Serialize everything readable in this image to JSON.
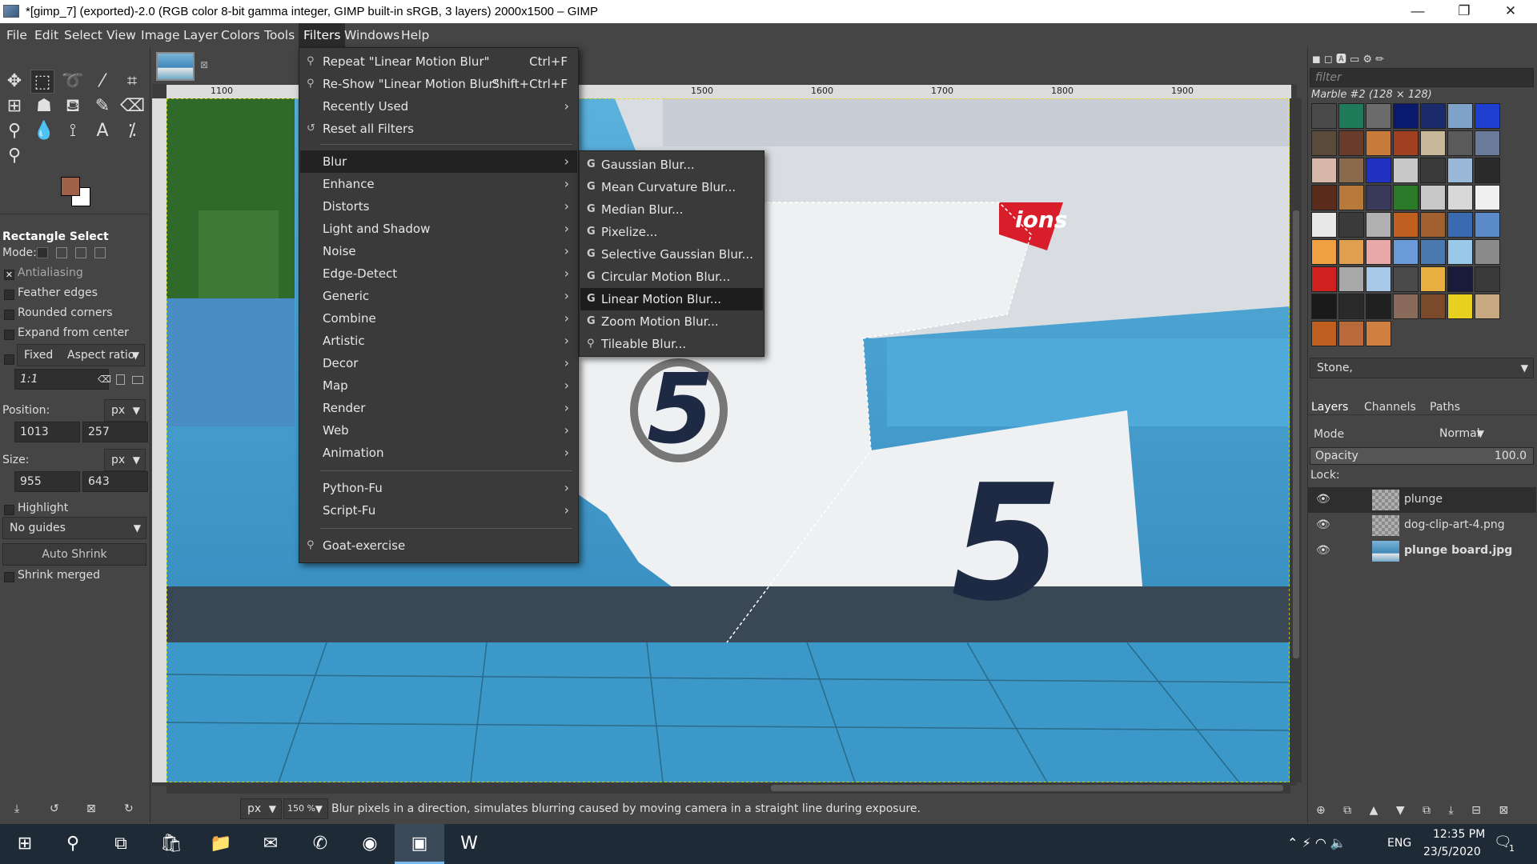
{
  "window": {
    "title": "*[gimp_7] (exported)-2.0 (RGB color 8-bit gamma integer, GIMP built-in sRGB, 3 layers) 2000x1500 – GIMP",
    "minimize": "—",
    "restore": "❐",
    "close": "✕"
  },
  "menubar": [
    "File",
    "Edit",
    "Select",
    "View",
    "Image",
    "Layer",
    "Colors",
    "Tools",
    "Filters",
    "Windows",
    "Help"
  ],
  "filters_menu": {
    "repeat": {
      "label": "Repeat \"Linear Motion Blur\"",
      "accel": "Ctrl+F"
    },
    "reshow": {
      "label": "Re-Show \"Linear Motion Blur\"",
      "accel": "Shift+Ctrl+F"
    },
    "recent": "Recently Used",
    "reset": "Reset all Filters",
    "groups": [
      "Blur",
      "Enhance",
      "Distorts",
      "Light and Shadow",
      "Noise",
      "Edge-Detect",
      "Generic",
      "Combine",
      "Artistic",
      "Decor",
      "Map",
      "Render",
      "Web",
      "Animation"
    ],
    "scripts": [
      "Python-Fu",
      "Script-Fu"
    ],
    "goat": "Goat-exercise"
  },
  "blur_menu": [
    "Gaussian Blur...",
    "Mean Curvature Blur...",
    "Median Blur...",
    "Pixelize...",
    "Selective Gaussian Blur...",
    "Circular Motion Blur...",
    "Linear Motion Blur...",
    "Zoom Motion Blur...",
    "Tileable Blur..."
  ],
  "tool_options": {
    "title": "Rectangle Select",
    "mode_label": "Mode:",
    "antialiasing": "Antialiasing",
    "feather": "Feather edges",
    "rounded": "Rounded corners",
    "expand": "Expand from center",
    "fixed": "Fixed",
    "fixed_value": "Aspect ratio",
    "ratio": "1:1",
    "position_label": "Position:",
    "unit": "px",
    "pos_x": "1013",
    "pos_y": "257",
    "size_label": "Size:",
    "size_w": "955",
    "size_h": "643",
    "highlight": "Highlight",
    "guides": "No guides",
    "auto_shrink": "Auto Shrink",
    "shrink_merged": "Shrink merged"
  },
  "ruler_ticks": [
    "1100",
    "1500",
    "1600",
    "1700",
    "1800",
    "1900"
  ],
  "canvas_text": {
    "number": "5",
    "sign": "ions"
  },
  "status": {
    "unit": "px",
    "zoom": "150 %",
    "message": "Blur pixels in a direction, simulates blurring caused by moving camera in a straight line during exposure."
  },
  "patterns": {
    "filter_placeholder": "filter",
    "name": "Marble #2 (128 × 128)",
    "selected": "Stone,",
    "swatches": [
      "#4a4a4a",
      "#1f7a5a",
      "#6b6b6b",
      "#0a1a6e",
      "#1a2a6a",
      "#7ea2c8",
      "#1e3fcf",
      "#5a4a3a",
      "#6a3a2a",
      "#c87a3a",
      "#a04020",
      "#c8b89a",
      "#5a5a5a",
      "#6a7a9a",
      "#d8b8a8",
      "#8a6a4a",
      "#2030c0",
      "#c8c8c8",
      "#3a3a3a",
      "#9ab8d8",
      "#2a2a2a",
      "#5a2a1a",
      "#b87a3a",
      "#3a3a5a",
      "#2a7a2a",
      "#c8c8c8",
      "#d8d8d8",
      "#f0f0f0",
      "#e8e8e8",
      "#3a3a3a",
      "#b0b0b0",
      "#c06020",
      "#a06030",
      "#3a6ab0",
      "#5a8ac8",
      "#f0a040",
      "#e0a050",
      "#e8a8a8",
      "#6a9ad8",
      "#4a7ab0",
      "#9ac8e8",
      "#8a8a8a",
      "#d02020",
      "#a8a8a8",
      "#a8c8e8",
      "#4a4a4a",
      "#e8b040",
      "#1a1a3a",
      "#3a3a3a",
      "#1a1a1a",
      "#2a2a2a",
      "#202020",
      "#8a6a5a",
      "#7a4a2a",
      "#e8d020",
      "#c8a880",
      "#c06020",
      "#b86a3a",
      "#d08040"
    ]
  },
  "layers": {
    "tabs": [
      "Layers",
      "Channels",
      "Paths"
    ],
    "mode_label": "Mode",
    "mode_value": "Normal",
    "opacity_label": "Opacity",
    "opacity_value": "100.0",
    "lock_label": "Lock:",
    "items": [
      {
        "name": "plunge"
      },
      {
        "name": "dog-clip-art-4.png"
      },
      {
        "name": "plunge board.jpg"
      }
    ]
  },
  "taskbar": {
    "time": "12:35 PM",
    "date": "23/5/2020",
    "lang": "ENG",
    "notif_count": "1"
  }
}
